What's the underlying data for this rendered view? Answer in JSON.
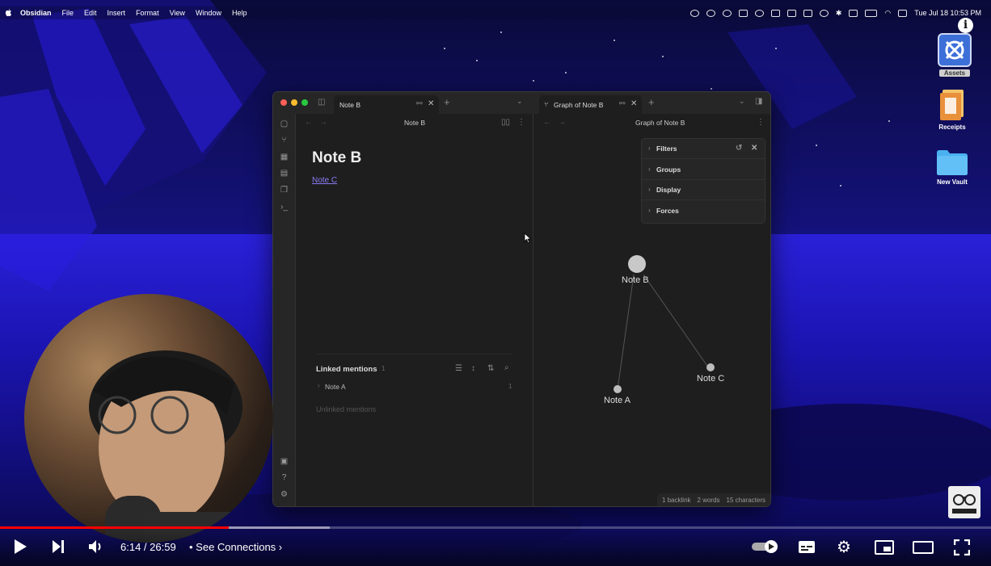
{
  "menubar": {
    "app_name": "Obsidian",
    "items": [
      "File",
      "Edit",
      "Insert",
      "Format",
      "View",
      "Window",
      "Help"
    ],
    "clock": "Tue Jul 18  10:53 PM"
  },
  "desktop": {
    "icons": [
      {
        "label": "Assets"
      },
      {
        "label": "Receipts"
      },
      {
        "label": "New Vault"
      }
    ]
  },
  "window": {
    "left_tab": {
      "label": "Note B"
    },
    "right_tab": {
      "label": "Graph of Note B"
    },
    "left_header": "Note B",
    "right_header": "Graph of Note B",
    "note": {
      "title": "Note B",
      "link": "Note C"
    },
    "backlinks": {
      "title": "Linked mentions",
      "count": "1",
      "items": [
        {
          "label": "Note A",
          "count": "1"
        }
      ],
      "unlinked": "Unlinked mentions"
    },
    "graph_controls": [
      "Filters",
      "Groups",
      "Display",
      "Forces"
    ],
    "graph_nodes": [
      {
        "label": "Note B"
      },
      {
        "label": "Note C"
      },
      {
        "label": "Note A"
      }
    ],
    "status": {
      "backlinks": "1 backlink",
      "words": "2 words",
      "characters": "15 characters"
    }
  },
  "player": {
    "time": "6:14 / 26:59",
    "chapter": "See Connections",
    "progress_fraction": 0.231,
    "accent": "#ff0000"
  },
  "colors": {
    "link": "#8b7bf5",
    "traffic_red": "#fe5f57",
    "traffic_yellow": "#febc2e",
    "traffic_green": "#28c840"
  }
}
